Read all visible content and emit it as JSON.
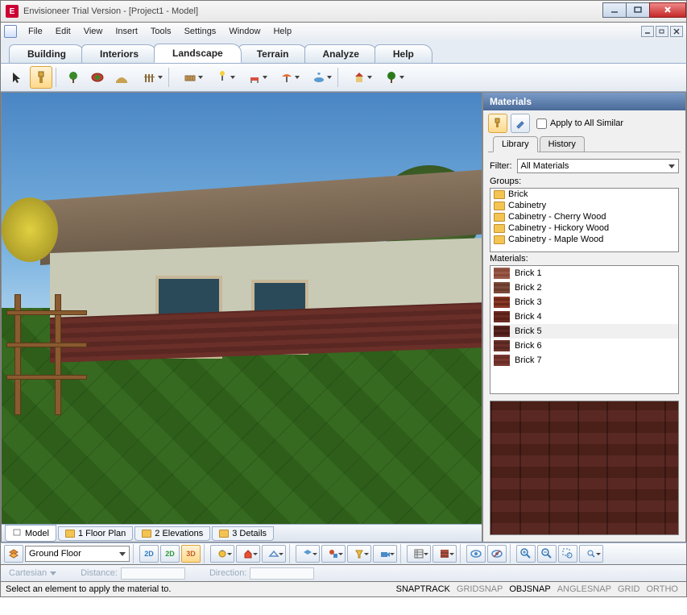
{
  "window": {
    "title": "Envisioneer Trial Version - [Project1 - Model]"
  },
  "menu": {
    "items": [
      "File",
      "Edit",
      "View",
      "Insert",
      "Tools",
      "Settings",
      "Window",
      "Help"
    ]
  },
  "tabs": {
    "items": [
      "Building",
      "Interiors",
      "Landscape",
      "Terrain",
      "Analyze",
      "Help"
    ],
    "active": 2
  },
  "materials": {
    "title": "Materials",
    "apply_all": "Apply to All Similar",
    "subtabs": [
      "Library",
      "History"
    ],
    "filter_label": "Filter:",
    "filter_value": "All Materials",
    "groups_label": "Groups:",
    "groups": [
      "Brick",
      "Cabinetry",
      "Cabinetry - Cherry Wood",
      "Cabinetry - Hickory Wood",
      "Cabinetry - Maple Wood"
    ],
    "materials_label": "Materials:",
    "items": [
      "Brick 1",
      "Brick 2",
      "Brick 3",
      "Brick 4",
      "Brick 5",
      "Brick 6",
      "Brick 7"
    ],
    "selected": 4
  },
  "viewport_tabs": {
    "items": [
      "Model",
      "1 Floor Plan",
      "2 Elevations",
      "3 Details"
    ],
    "active": 0
  },
  "bottom": {
    "floor": "Ground Floor"
  },
  "coords": {
    "system": "Cartesian",
    "distance_label": "Distance:",
    "direction_label": "Direction:"
  },
  "status": {
    "message": "Select an element to apply the material to.",
    "snaps": [
      "SNAPTRACK",
      "GRIDSNAP",
      "OBJSNAP",
      "ANGLESNAP",
      "GRID",
      "ORTHO"
    ],
    "snaps_active": [
      0,
      2
    ]
  }
}
